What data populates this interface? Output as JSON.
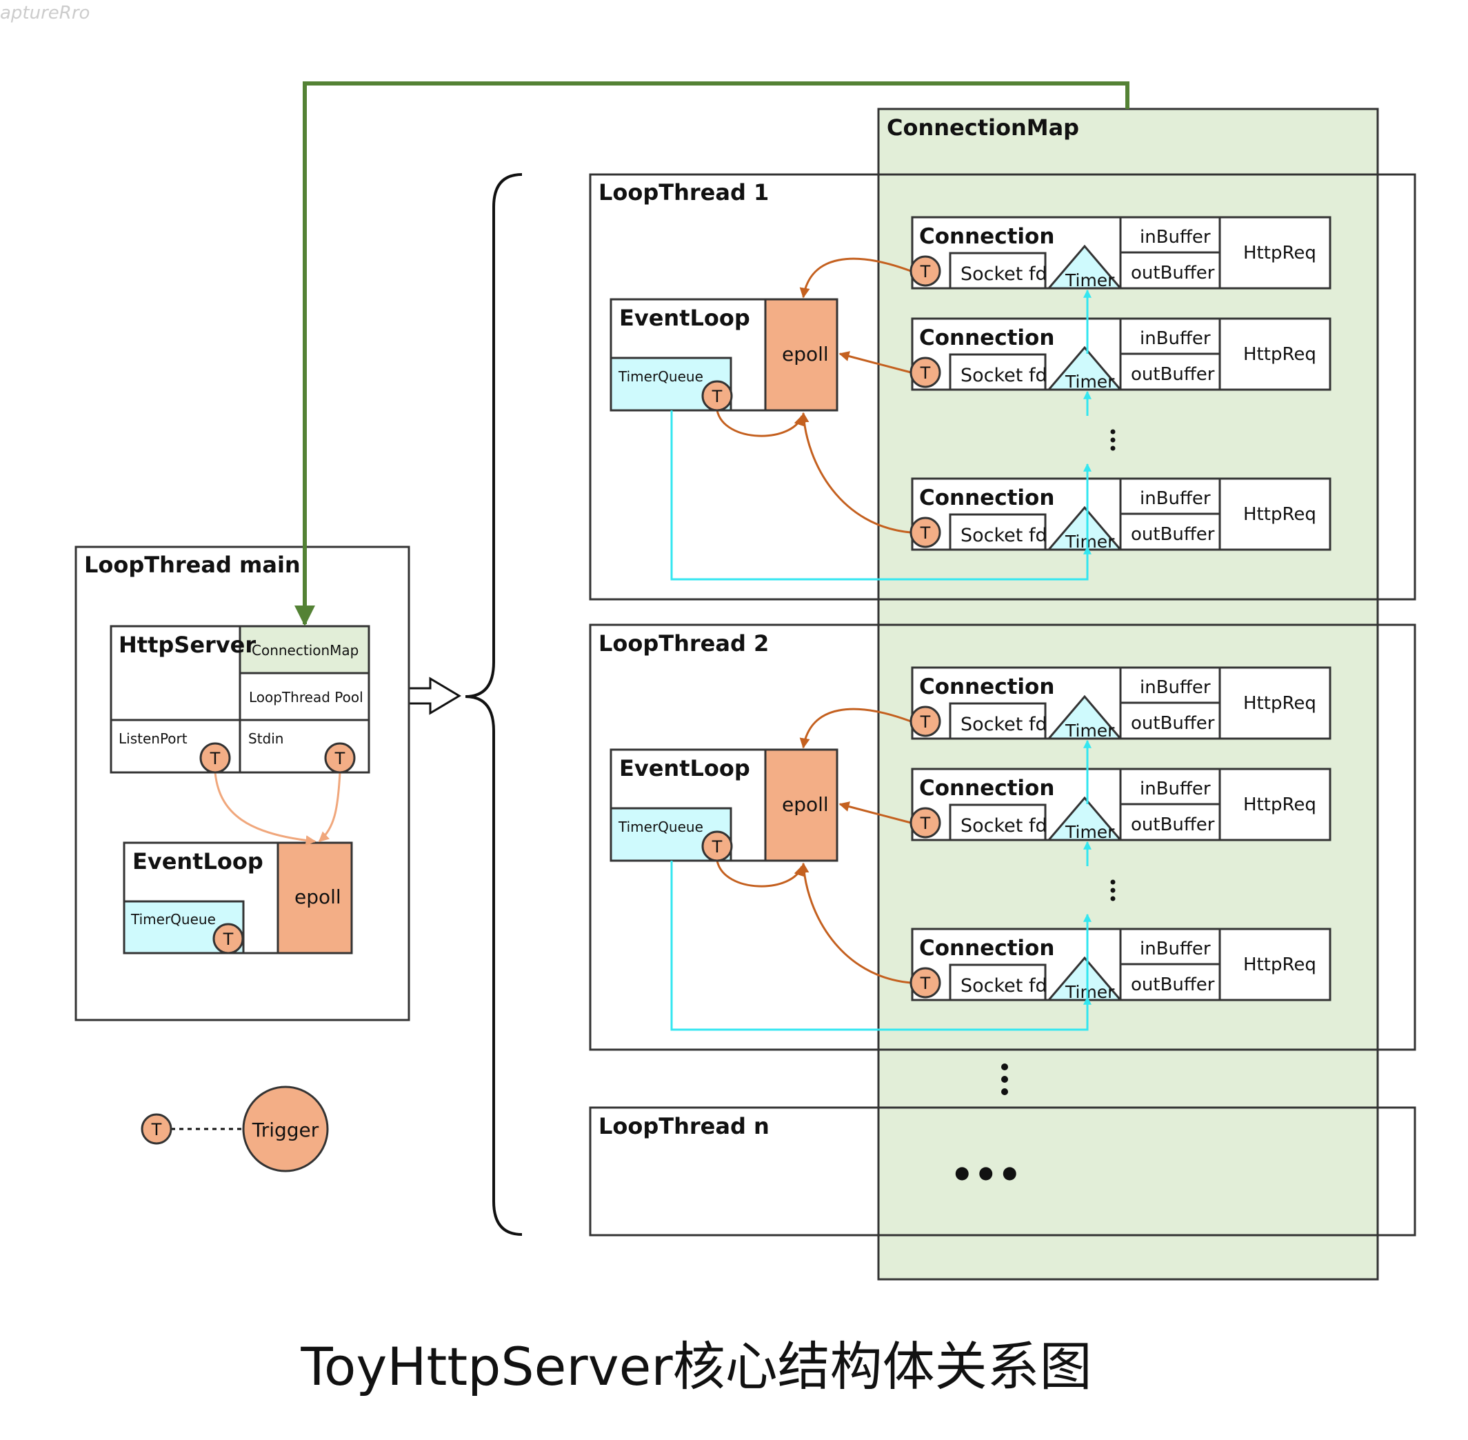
{
  "watermark": "aptureRro",
  "caption": "ToyHttpServer核心结构体关系图",
  "colors": {
    "connection_map_fill": "#e2eed8",
    "timer_fill": "#cffafd",
    "trigger_fill": "#f3ae86",
    "epoll_fill": "#f3ae86",
    "cyan_arrow": "#33e6f0",
    "orange_arrow": "#c4601f",
    "light_orange_arrow": "#f0a77c",
    "green_arrow": "#548235"
  },
  "connection_map": {
    "label": "ConnectionMap"
  },
  "main_thread": {
    "title": "LoopThread main",
    "http_server": {
      "label": "HttpServer",
      "connection_map": "ConnectionMap",
      "thread_pool": "LoopThread Pool",
      "listen_port": "ListenPort",
      "stdin": "Stdin"
    },
    "event_loop": {
      "label": "EventLoop",
      "timer_queue": "TimerQueue",
      "epoll": "epoll"
    }
  },
  "loop_threads": [
    {
      "title": "LoopThread 1"
    },
    {
      "title": "LoopThread 2"
    },
    {
      "title": "LoopThread n",
      "ellipsis": "•••"
    }
  ],
  "event_loop": {
    "label": "EventLoop",
    "timer_queue": "TimerQueue",
    "epoll": "epoll"
  },
  "connection": {
    "label": "Connection",
    "socket": "Socket fd",
    "timer": "Timer",
    "in_buffer": "inBuffer",
    "out_buffer": "outBuffer",
    "request": "HttpReq"
  },
  "trigger_symbol": "T",
  "legend": {
    "symbol": "T",
    "label": "Trigger"
  }
}
